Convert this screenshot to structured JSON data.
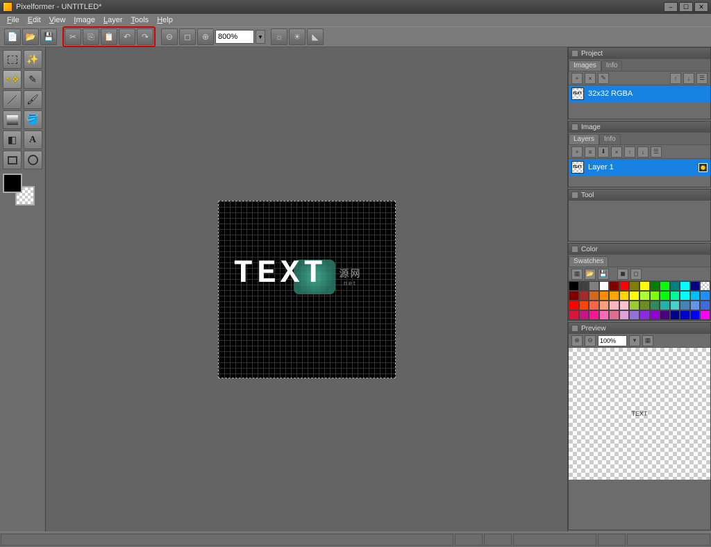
{
  "app": {
    "title": "Pixelformer - UNTITLED*"
  },
  "menu": [
    "File",
    "Edit",
    "View",
    "Image",
    "Layer",
    "Tools",
    "Help"
  ],
  "toolbar": {
    "zoom": "800%",
    "icons": [
      "new-file",
      "open-file",
      "save-file"
    ],
    "highlighted": [
      "cut",
      "copy",
      "paste",
      "undo",
      "redo"
    ],
    "zoom_icons": [
      "zoom-out",
      "zoom-fit",
      "zoom-in"
    ],
    "right_icons": [
      "brightness",
      "sun",
      "mountain"
    ]
  },
  "panels": {
    "project": {
      "title": "Project",
      "tabs": [
        "Images",
        "Info"
      ],
      "item": "32x32 RGBA"
    },
    "image": {
      "title": "Image",
      "tabs": [
        "Layers",
        "Info"
      ],
      "item": "Layer 1"
    },
    "tool": {
      "title": "Tool"
    },
    "color": {
      "title": "Color",
      "tabs": [
        "Swatches"
      ]
    },
    "preview": {
      "title": "Preview",
      "zoom": "100%",
      "text": "TEXT"
    }
  },
  "canvas": {
    "text": "TEXT",
    "watermark": "源网",
    "watermark_sub": ".net"
  },
  "swatches": [
    "#000",
    "#404040",
    "#808080",
    "#fff",
    "#800000",
    "#f00",
    "#808000",
    "#ff0",
    "#008000",
    "#0f0",
    "#008080",
    "#0ff",
    "#000080",
    "repeating-conic-gradient(#fff 0 25%,#ccc 0 50%) 0 0/6px 6px",
    "#800000",
    "#a52a2a",
    "#d2691e",
    "#ff8c00",
    "#ffa500",
    "#ffd700",
    "#ff0",
    "#adff2f",
    "#7fff00",
    "#0f0",
    "#00fa9a",
    "#00ffff",
    "#00bfff",
    "#1e90ff",
    "#f00",
    "#ff4500",
    "#ff6347",
    "#ffa07a",
    "#ffb6c1",
    "#ffc0cb",
    "#9acd32",
    "#6b8e23",
    "#2e8b57",
    "#20b2aa",
    "#48d1cc",
    "#4682b4",
    "#6495ed",
    "#4169e1",
    "#dc143c",
    "#c71585",
    "#ff1493",
    "#ff69b4",
    "#db7093",
    "#dda0dd",
    "#9370db",
    "#8a2be2",
    "#9400d3",
    "#4b0082",
    "#00008b",
    "#0000cd",
    "#00f",
    "#f0f"
  ]
}
